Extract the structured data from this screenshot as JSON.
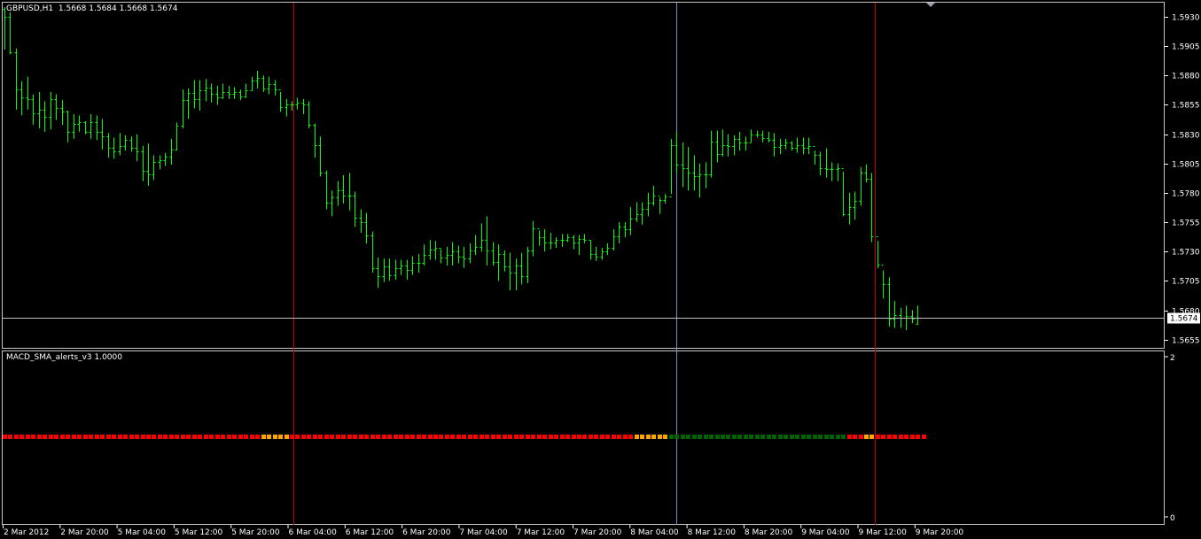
{
  "window": {
    "title_symbol": "GBPUSD,H1",
    "ohlc": "1.5668 1.5684 1.5668 1.5674"
  },
  "indicator": {
    "title": "MACD_SMA_alerts_v3 1.0000",
    "scale_max": "2",
    "scale_min": "0",
    "colors": {
      "red": "#ff0000",
      "orange": "#ffa500",
      "green": "#006400"
    },
    "states": "RRRRRRRRRRRRRRRRRRRRRRRRRRRRRRRRRRRRRRRRRRRRRRRRRRRRRRRRRRRRRRRRRRRRRRRRRRRRRRRRRRRRRRRRRRRRRRRRRRRRRRRRRRRRRRRRRRRRRRRRRRRRRRRRRRRRRRRRRRRRRRRRRRRRRRRRRRRRRRRRRRRRRRRRRRRRRRRRRRRRRRRRRRRRRRRRRRRRRRRRRRRRRRRRR"
  },
  "price_axis": {
    "ticks": [
      "1.5930",
      "1.5905",
      "1.5880",
      "1.5855",
      "1.5830",
      "1.5805",
      "1.5780",
      "1.5755",
      "1.5730",
      "1.5705",
      "1.5680",
      "1.5655"
    ],
    "current_price": "1.5674",
    "colors": {
      "text": "#ffffff",
      "bid_line": "#c0c0c0",
      "bars": "#00ff00"
    }
  },
  "time_axis": {
    "labels": [
      "2 Mar 2012",
      "2 Mar 20:00",
      "5 Mar 04:00",
      "5 Mar 12:00",
      "5 Mar 20:00",
      "6 Mar 04:00",
      "6 Mar 12:00",
      "6 Mar 20:00",
      "7 Mar 04:00",
      "7 Mar 12:00",
      "7 Mar 20:00",
      "8 Mar 04:00",
      "8 Mar 12:00",
      "8 Mar 20:00",
      "9 Mar 04:00",
      "9 Mar 12:00",
      "9 Mar 20:00"
    ]
  },
  "vertical_markers": [
    {
      "color": "#c00000"
    },
    {
      "color": "#7a8fc8"
    },
    {
      "color": "#c00000"
    }
  ],
  "chart_data": {
    "type": "ohlc",
    "symbol": "GBPUSD",
    "timeframe": "H1",
    "ylim": [
      1.5648,
      1.5942
    ],
    "bars": [
      [
        1.5937,
        1.5938,
        1.5902,
        1.593
      ],
      [
        1.593,
        1.5934,
        1.5898,
        1.59
      ],
      [
        1.59,
        1.5903,
        1.5851,
        1.5868
      ],
      [
        1.5868,
        1.5875,
        1.5846,
        1.5861
      ],
      [
        1.5861,
        1.5879,
        1.5851,
        1.586
      ],
      [
        1.586,
        1.5864,
        1.5838,
        1.5848
      ],
      [
        1.5848,
        1.5866,
        1.5835,
        1.5851
      ],
      [
        1.5851,
        1.5858,
        1.5832,
        1.5845
      ],
      [
        1.5845,
        1.5866,
        1.5834,
        1.586
      ],
      [
        1.586,
        1.5864,
        1.5842,
        1.5852
      ],
      [
        1.5852,
        1.5859,
        1.5838,
        1.5849
      ],
      [
        1.5849,
        1.585,
        1.5823,
        1.5832
      ],
      [
        1.5832,
        1.5847,
        1.5826,
        1.5839
      ],
      [
        1.5839,
        1.5846,
        1.5832,
        1.584
      ],
      [
        1.584,
        1.5841,
        1.583,
        1.5832
      ],
      [
        1.5832,
        1.5847,
        1.5826,
        1.584
      ],
      [
        1.584,
        1.5846,
        1.5825,
        1.5832
      ],
      [
        1.5832,
        1.5843,
        1.5817,
        1.5828
      ],
      [
        1.5828,
        1.5831,
        1.581,
        1.5818
      ],
      [
        1.5818,
        1.5827,
        1.5809,
        1.5815
      ],
      [
        1.5815,
        1.5831,
        1.5812,
        1.582
      ],
      [
        1.582,
        1.5829,
        1.5816,
        1.5825
      ],
      [
        1.5825,
        1.5828,
        1.5815,
        1.5818
      ],
      [
        1.5818,
        1.583,
        1.5807,
        1.5815
      ],
      [
        1.5815,
        1.582,
        1.579,
        1.5799
      ],
      [
        1.5799,
        1.5822,
        1.5786,
        1.5796
      ],
      [
        1.5796,
        1.5812,
        1.5791,
        1.5806
      ],
      [
        1.5806,
        1.5812,
        1.58,
        1.5808
      ],
      [
        1.5808,
        1.5814,
        1.5803,
        1.5811
      ],
      [
        1.5811,
        1.5826,
        1.5804,
        1.5817
      ],
      [
        1.5817,
        1.584,
        1.5816,
        1.5837
      ],
      [
        1.5837,
        1.5868,
        1.5835,
        1.5859
      ],
      [
        1.5859,
        1.5869,
        1.5843,
        1.5865
      ],
      [
        1.5865,
        1.5876,
        1.5852,
        1.586
      ],
      [
        1.586,
        1.5876,
        1.585,
        1.5867
      ],
      [
        1.5867,
        1.5877,
        1.5858,
        1.587
      ],
      [
        1.587,
        1.5873,
        1.5857,
        1.5864
      ],
      [
        1.5864,
        1.5871,
        1.5855,
        1.5861
      ],
      [
        1.5861,
        1.5873,
        1.586,
        1.5866
      ],
      [
        1.5866,
        1.5871,
        1.586,
        1.5864
      ],
      [
        1.5864,
        1.587,
        1.586,
        1.5866
      ],
      [
        1.5866,
        1.5868,
        1.5859,
        1.5862
      ],
      [
        1.5862,
        1.5873,
        1.5861,
        1.5867
      ],
      [
        1.5867,
        1.5879,
        1.5867,
        1.5876
      ],
      [
        1.5876,
        1.5884,
        1.5869,
        1.5878
      ],
      [
        1.5878,
        1.588,
        1.5866,
        1.5869
      ],
      [
        1.5869,
        1.5879,
        1.5864,
        1.5873
      ],
      [
        1.5873,
        1.5876,
        1.5863,
        1.5868
      ],
      [
        1.5868,
        1.5866,
        1.5849,
        1.5853
      ],
      [
        1.5853,
        1.586,
        1.5845,
        1.5855
      ],
      [
        1.5855,
        1.5858,
        1.585,
        1.5855
      ],
      [
        1.5855,
        1.5861,
        1.5851,
        1.5857
      ],
      [
        1.5857,
        1.586,
        1.5847,
        1.5855
      ],
      [
        1.5855,
        1.5858,
        1.5835,
        1.5838
      ],
      [
        1.5838,
        1.5839,
        1.581,
        1.5821
      ],
      [
        1.5821,
        1.5828,
        1.5794,
        1.5797
      ],
      [
        1.5797,
        1.5799,
        1.5766,
        1.5772
      ],
      [
        1.5772,
        1.5782,
        1.576,
        1.5776
      ],
      [
        1.5776,
        1.579,
        1.5769,
        1.5782
      ],
      [
        1.5782,
        1.5795,
        1.5771,
        1.5778
      ],
      [
        1.5778,
        1.5797,
        1.5765,
        1.5778
      ],
      [
        1.5778,
        1.5781,
        1.5751,
        1.5759
      ],
      [
        1.5759,
        1.5766,
        1.5746,
        1.5755
      ],
      [
        1.5755,
        1.5763,
        1.5737,
        1.5744
      ],
      [
        1.5744,
        1.5747,
        1.5712,
        1.5716
      ],
      [
        1.5716,
        1.5725,
        1.5699,
        1.5709
      ],
      [
        1.5709,
        1.5724,
        1.5704,
        1.5717
      ],
      [
        1.5717,
        1.5724,
        1.5705,
        1.571
      ],
      [
        1.571,
        1.5723,
        1.5706,
        1.5716
      ],
      [
        1.5716,
        1.5723,
        1.571,
        1.5718
      ],
      [
        1.5718,
        1.5723,
        1.5706,
        1.5714
      ],
      [
        1.5714,
        1.5726,
        1.571,
        1.572
      ],
      [
        1.572,
        1.5728,
        1.5712,
        1.572
      ],
      [
        1.572,
        1.5736,
        1.5718,
        1.5727
      ],
      [
        1.5727,
        1.574,
        1.5723,
        1.5732
      ],
      [
        1.5732,
        1.5739,
        1.5723,
        1.5733
      ],
      [
        1.5733,
        1.5732,
        1.572,
        1.5725
      ],
      [
        1.5725,
        1.5734,
        1.5718,
        1.5727
      ],
      [
        1.5727,
        1.5738,
        1.5718,
        1.573
      ],
      [
        1.573,
        1.5735,
        1.572,
        1.5726
      ],
      [
        1.5726,
        1.5734,
        1.5716,
        1.5724
      ],
      [
        1.5724,
        1.5737,
        1.572,
        1.5731
      ],
      [
        1.5731,
        1.5744,
        1.5727,
        1.5734
      ],
      [
        1.5734,
        1.5754,
        1.573,
        1.574
      ],
      [
        1.574,
        1.576,
        1.5718,
        1.5731
      ],
      [
        1.5731,
        1.5738,
        1.5718,
        1.5721
      ],
      [
        1.5721,
        1.5736,
        1.5705,
        1.5728
      ],
      [
        1.5728,
        1.5731,
        1.5713,
        1.5717
      ],
      [
        1.5717,
        1.5729,
        1.5697,
        1.5712
      ],
      [
        1.5712,
        1.5724,
        1.5697,
        1.5718
      ],
      [
        1.5718,
        1.5729,
        1.5702,
        1.5709
      ],
      [
        1.5709,
        1.5734,
        1.5703,
        1.5731
      ],
      [
        1.5731,
        1.5756,
        1.5726,
        1.575
      ],
      [
        1.575,
        1.5748,
        1.5735,
        1.5742
      ],
      [
        1.5742,
        1.5749,
        1.573,
        1.5738
      ],
      [
        1.5738,
        1.5746,
        1.5732,
        1.5738
      ],
      [
        1.5738,
        1.5742,
        1.5733,
        1.574
      ],
      [
        1.574,
        1.5745,
        1.5734,
        1.574
      ],
      [
        1.574,
        1.5745,
        1.5738,
        1.5742
      ],
      [
        1.5742,
        1.5744,
        1.5732,
        1.5738
      ],
      [
        1.5738,
        1.5744,
        1.5727,
        1.5741
      ],
      [
        1.5741,
        1.5745,
        1.5737,
        1.574
      ],
      [
        1.574,
        1.574,
        1.5723,
        1.5728
      ],
      [
        1.5728,
        1.5734,
        1.5722,
        1.5726
      ],
      [
        1.5726,
        1.5733,
        1.5723,
        1.573
      ],
      [
        1.573,
        1.5737,
        1.5727,
        1.5733
      ],
      [
        1.5733,
        1.5749,
        1.5731,
        1.5743
      ],
      [
        1.5743,
        1.5755,
        1.5737,
        1.5751
      ],
      [
        1.5751,
        1.5755,
        1.5742,
        1.5749
      ],
      [
        1.5749,
        1.5768,
        1.5744,
        1.5758
      ],
      [
        1.5758,
        1.5772,
        1.5755,
        1.5762
      ],
      [
        1.5762,
        1.5772,
        1.5753,
        1.5766
      ],
      [
        1.5766,
        1.578,
        1.576,
        1.5772
      ],
      [
        1.5772,
        1.5786,
        1.5769,
        1.5778
      ],
      [
        1.5778,
        1.5776,
        1.5762,
        1.5774
      ],
      [
        1.5774,
        1.5779,
        1.5771,
        1.5777
      ],
      [
        1.5777,
        1.5826,
        1.5779,
        1.5821
      ],
      [
        1.5821,
        1.5832,
        1.5797,
        1.5804
      ],
      [
        1.5804,
        1.5823,
        1.5785,
        1.5801
      ],
      [
        1.5801,
        1.5819,
        1.5782,
        1.5797
      ],
      [
        1.5797,
        1.5812,
        1.5782,
        1.5794
      ],
      [
        1.5794,
        1.5805,
        1.5776,
        1.5796
      ],
      [
        1.5796,
        1.5806,
        1.5784,
        1.5796
      ],
      [
        1.5796,
        1.5833,
        1.5793,
        1.5824
      ],
      [
        1.5824,
        1.5833,
        1.5806,
        1.5813
      ],
      [
        1.5813,
        1.5834,
        1.5811,
        1.5821
      ],
      [
        1.5821,
        1.583,
        1.5811,
        1.582
      ],
      [
        1.582,
        1.5829,
        1.5812,
        1.5826
      ],
      [
        1.5826,
        1.5832,
        1.5816,
        1.5823
      ],
      [
        1.5823,
        1.5828,
        1.5816,
        1.5823
      ],
      [
        1.5823,
        1.5834,
        1.5823,
        1.583
      ],
      [
        1.583,
        1.5833,
        1.5827,
        1.583
      ],
      [
        1.583,
        1.5833,
        1.5823,
        1.5827
      ],
      [
        1.5827,
        1.5832,
        1.5823,
        1.5825
      ],
      [
        1.5825,
        1.5831,
        1.5811,
        1.5819
      ],
      [
        1.5819,
        1.5826,
        1.5813,
        1.5821
      ],
      [
        1.5821,
        1.5826,
        1.5817,
        1.5823
      ],
      [
        1.5823,
        1.5824,
        1.5816,
        1.5818
      ],
      [
        1.5818,
        1.5827,
        1.5814,
        1.5821
      ],
      [
        1.5821,
        1.5827,
        1.5813,
        1.5818
      ],
      [
        1.5818,
        1.5827,
        1.5813,
        1.582
      ],
      [
        1.582,
        1.5816,
        1.5804,
        1.5812
      ],
      [
        1.5812,
        1.5815,
        1.5795,
        1.5801
      ],
      [
        1.5801,
        1.5818,
        1.5793,
        1.58
      ],
      [
        1.58,
        1.5806,
        1.579,
        1.58
      ],
      [
        1.58,
        1.5805,
        1.579,
        1.5801
      ],
      [
        1.5801,
        1.5798,
        1.576,
        1.5762
      ],
      [
        1.5762,
        1.578,
        1.5753,
        1.5768
      ],
      [
        1.5768,
        1.5781,
        1.5757,
        1.5773
      ],
      [
        1.5773,
        1.5802,
        1.5769,
        1.5797
      ],
      [
        1.5797,
        1.5804,
        1.5789,
        1.5792
      ],
      [
        1.5792,
        1.5797,
        1.5738,
        1.5743
      ],
      [
        1.5743,
        1.5739,
        1.5716,
        1.5719
      ],
      [
        1.5719,
        1.5714,
        1.569,
        1.5702
      ],
      [
        1.5702,
        1.5708,
        1.5666,
        1.5673
      ],
      [
        1.5673,
        1.5688,
        1.5665,
        1.5676
      ],
      [
        1.5676,
        1.5682,
        1.5665,
        1.5674
      ],
      [
        1.5674,
        1.5684,
        1.5663,
        1.5675
      ],
      [
        1.5675,
        1.568,
        1.5669,
        1.5673
      ],
      [
        1.5668,
        1.5684,
        1.5668,
        1.5674
      ]
    ]
  }
}
